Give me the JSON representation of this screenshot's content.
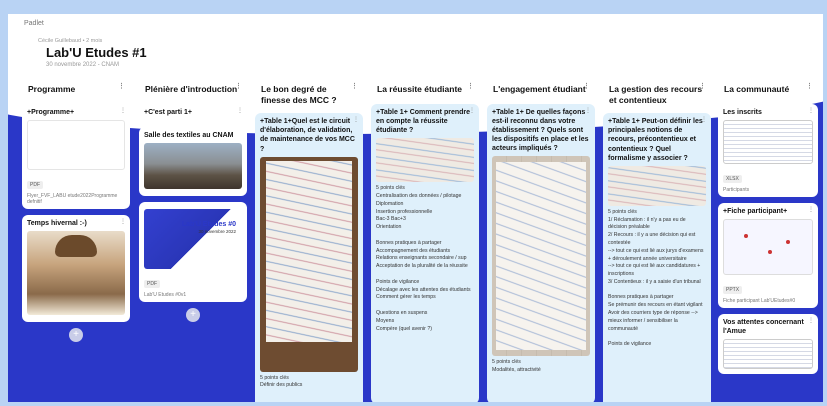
{
  "app": {
    "brand": "Padlet"
  },
  "board": {
    "meta": "Cécile Guillebaud • 2 mois",
    "title": "Lab'U Etudes #1",
    "subtitle": "30 novembre 2022 - CNAM"
  },
  "columns": [
    {
      "title": "Programme",
      "cards": [
        {
          "title": "+Programme+",
          "file_type": "PDF",
          "caption": "Flyer_FVF_LABU etude2022Programme defnitif"
        },
        {
          "title": "Temps hivernal :-)"
        }
      ]
    },
    {
      "title": "Plénière d'introduction",
      "cards": [
        {
          "title": "+C'est parti 1+"
        },
        {
          "title": "Salle des textiles au CNAM"
        },
        {
          "slide_title": "Lab'U Etudes #0",
          "slide_date": "30 novembre 2022",
          "file_type": "PDF",
          "caption": "Lab'U Etudes #0v1"
        }
      ]
    },
    {
      "title": "Le bon degré de finesse des MCC ?",
      "cards": [
        {
          "title": "+Table 1+Quel est le circuit d'élaboration, de validation, de maintenance de vos MCC ?",
          "footer": "5 points clés\nDéfinir des publics"
        }
      ]
    },
    {
      "title": "La réussite étudiante",
      "cards": [
        {
          "title": "+Table 1+ Comment prendre en compte la réussite étudiante ?",
          "body": "5 points clés\nCentralisation des données / pilotage\nDiplomation\nInsertion professionnelle\nBac-3 Bac+3\nOrientation\n\nBonnes pratiques à partager\nAccompagnement des étudiants\nRelations enseignants secondaire / sup\nAcceptation de la pluralité de la réussite\n\nPoints de vigilance\nDécalage avec les attentes des étudiants\nComment gérer les temps\n\nQuestions en suspens\nMoyens\nCompère (quel avenir ?)"
        }
      ]
    },
    {
      "title": "L'engagement étudiant",
      "cards": [
        {
          "title": "+Table 1+ De quelles façons est-il reconnu dans votre établissement ? Quels sont les dispositifs en place et les acteurs impliqués ?",
          "footer": "5 points clés\nModalités, attractivité"
        }
      ]
    },
    {
      "title": "La gestion des recours et contentieux",
      "cards": [
        {
          "title": "+Table 1+ Peut-on définir les principales notions de recours, précontentieux et contentieux ? Quel formalisme y associer ?",
          "body": "5 points clés\n1/ Réclamation : il n'y a pas eu de décision préalable\n2/ Recours : il y a une décision qui est contestée\n--> tout ce qui est lié aux jurys d'examens + déroulement année universitaire\n--> tout ce qui est lié aux candidatures + inscriptions\n3/ Contentieux : il y a saisie d'un tribunal\n\nBonnes pratiques à partager\nSe prémunir des recours en étant vigilant\nAvoir des courriers type de réponse --> mieux informer / sensibiliser la communauté\n\nPoints de vigilance"
        }
      ]
    },
    {
      "title": "La communauté",
      "cards": [
        {
          "title": "Les inscrits",
          "file_type": "XLSX",
          "caption": "Participants"
        },
        {
          "title": "+Fiche participant+",
          "file_type": "PPTX",
          "caption": "Fiche participant Lab'UEtudes#0"
        },
        {
          "title": "Vos attentes concernant l'Amue"
        }
      ]
    }
  ],
  "controls": {
    "add_label": "+",
    "more_label": "⋮"
  }
}
